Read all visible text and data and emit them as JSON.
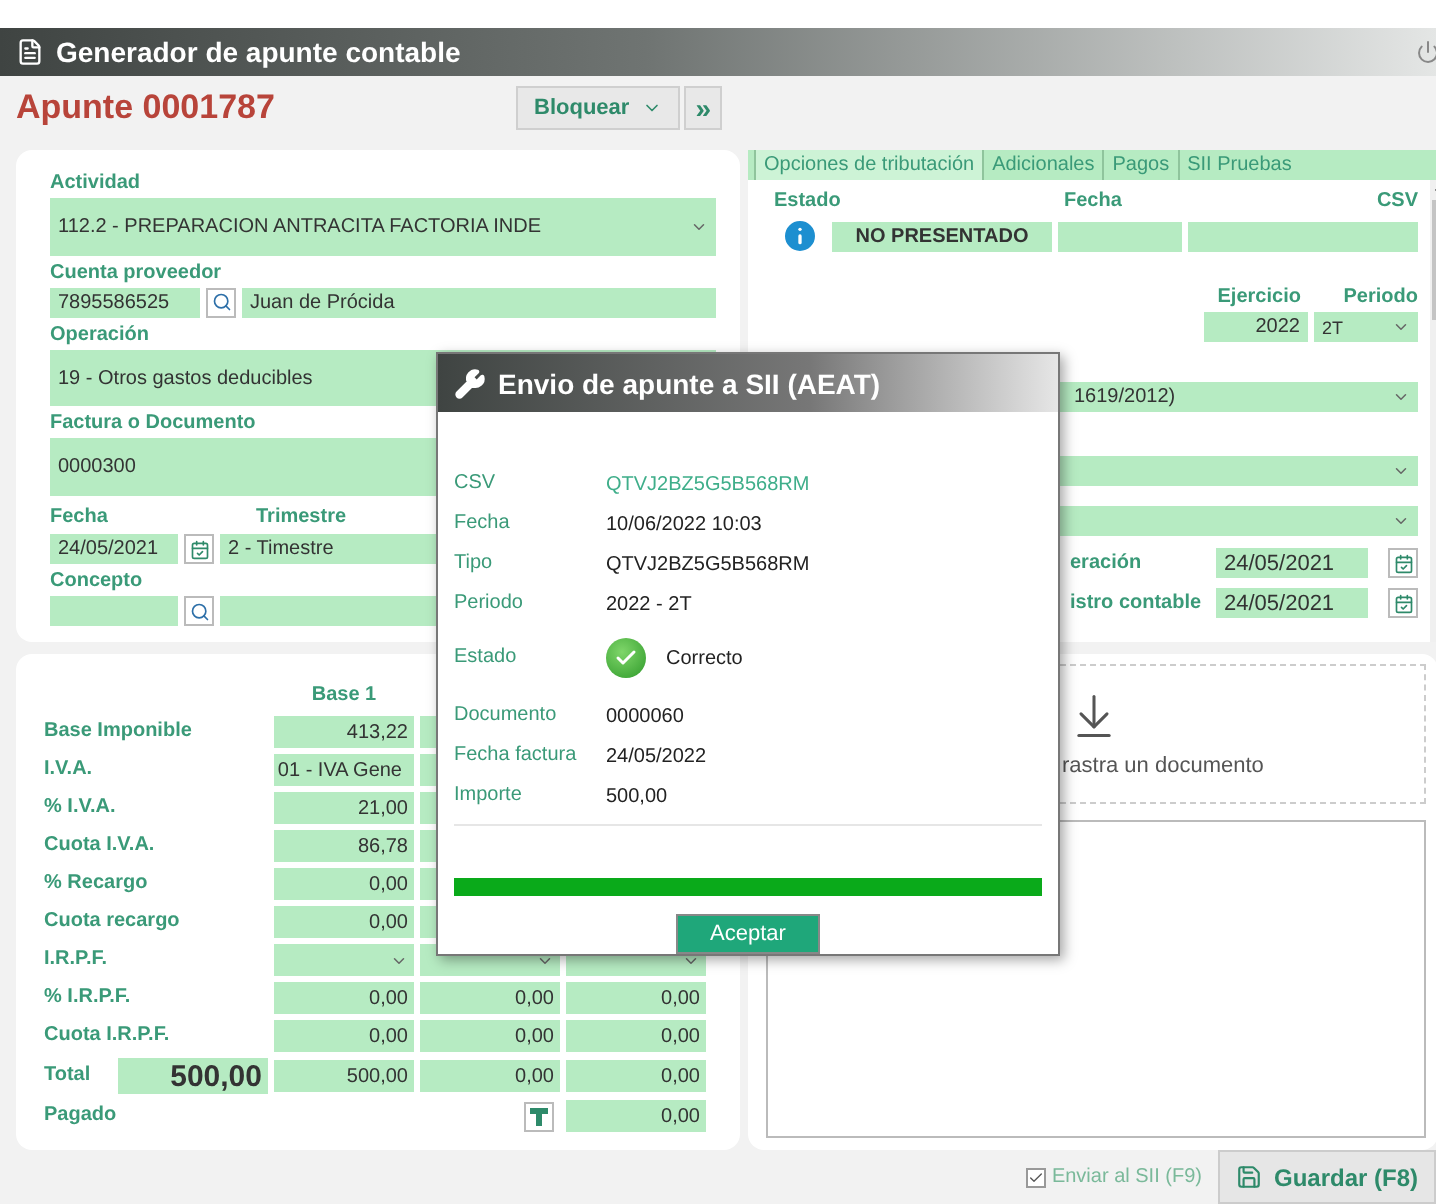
{
  "window": {
    "title": "Generador de apunte contable"
  },
  "header": {
    "title": "Apunte 0001787",
    "lock_button": "Bloquear",
    "next_button": "»"
  },
  "form": {
    "actividad": {
      "label": "Actividad",
      "value": "112.2 - PREPARACION ANTRACITA FACTORIA INDE"
    },
    "proveedor": {
      "label": "Cuenta proveedor",
      "code": "7895586525",
      "name": "Juan de Prócida"
    },
    "operacion": {
      "label": "Operación",
      "value": "19 - Otros gastos deducibles"
    },
    "factura": {
      "label": "Factura o Documento",
      "value": "0000300"
    },
    "fecha": {
      "label": "Fecha",
      "value": "24/05/2021"
    },
    "trimestre": {
      "label": "Trimestre",
      "value": "2 - Timestre"
    },
    "concepto": {
      "label": "Concepto"
    }
  },
  "tabs": [
    {
      "label": "Opciones de tributación",
      "selected": true
    },
    {
      "label": "Adicionales",
      "selected": false
    },
    {
      "label": "Pagos",
      "selected": false
    },
    {
      "label": "SII Pruebas",
      "selected": false
    }
  ],
  "sii": {
    "estado_label": "Estado",
    "fecha_label": "Fecha",
    "csv_label": "CSV",
    "estado": "NO PRESENTADO",
    "ejercicio_label": "Ejercicio",
    "periodo_label": "Periodo",
    "ejercicio": "2022",
    "periodo": "2T",
    "tipo_factura": "1619/2012)",
    "fecha_operacion_label": "eración",
    "fecha_operacion": "24/05/2021",
    "fecha_registro_label": "istro contable",
    "fecha_registro": "24/05/2021"
  },
  "taxes": {
    "column_header": "Base 1",
    "rows": [
      {
        "label": "Base Imponible",
        "kind": "number",
        "base_1": "413,22"
      },
      {
        "label": "I.V.A.",
        "kind": "select",
        "base_1": "01 - IVA Gene"
      },
      {
        "label": "% I.V.A.",
        "kind": "number",
        "base_1": "21,00"
      },
      {
        "label": "Cuota I.V.A.",
        "kind": "number",
        "base_1": "86,78"
      },
      {
        "label": "% Recargo",
        "kind": "number",
        "base_1": "0,00"
      },
      {
        "label": "Cuota recargo",
        "kind": "number",
        "base_1": "0,00"
      },
      {
        "label": "I.R.P.F.",
        "kind": "select"
      },
      {
        "label": "% I.R.P.F.",
        "kind": "number",
        "base_1": "0,00",
        "base_2": "0,00",
        "base_3": "0,00"
      },
      {
        "label": "Cuota I.R.P.F.",
        "kind": "number",
        "base_1": "0,00",
        "base_2": "0,00",
        "base_3": "0,00"
      },
      {
        "label": "Total",
        "kind": "total",
        "total": "500,00",
        "base_1": "500,00",
        "base_2": "0,00",
        "base_3": "0,00"
      },
      {
        "label": "Pagado",
        "kind": "paid",
        "base_3": "0,00"
      }
    ]
  },
  "drop_zone": {
    "text": "rastra un documento"
  },
  "footer": {
    "send": {
      "label": "Enviar al SII (F9)",
      "checked": true
    },
    "save": "Guardar (F8)"
  },
  "dialog": {
    "title": "Envio de apunte a SII (AEAT)",
    "rows": [
      {
        "label": "CSV",
        "value": "QTVJ2BZ5G5B568RM",
        "kind": "link"
      },
      {
        "label": "Fecha",
        "value": "10/06/2022 10:03",
        "kind": "text"
      },
      {
        "label": "Tipo",
        "value": "QTVJ2BZ5G5B568RM",
        "kind": "text"
      },
      {
        "label": "Periodo",
        "value": "2022 - 2T",
        "kind": "text"
      },
      {
        "label": "Estado",
        "value": "Correcto",
        "kind": "status"
      },
      {
        "label": "Documento",
        "value": "0000060",
        "kind": "text"
      },
      {
        "label": "Fecha factura",
        "value": "24/05/2022",
        "kind": "text"
      },
      {
        "label": "Importe",
        "value": "500,00",
        "kind": "text"
      }
    ],
    "progress": {
      "level": 1
    },
    "button": "Aceptar"
  }
}
